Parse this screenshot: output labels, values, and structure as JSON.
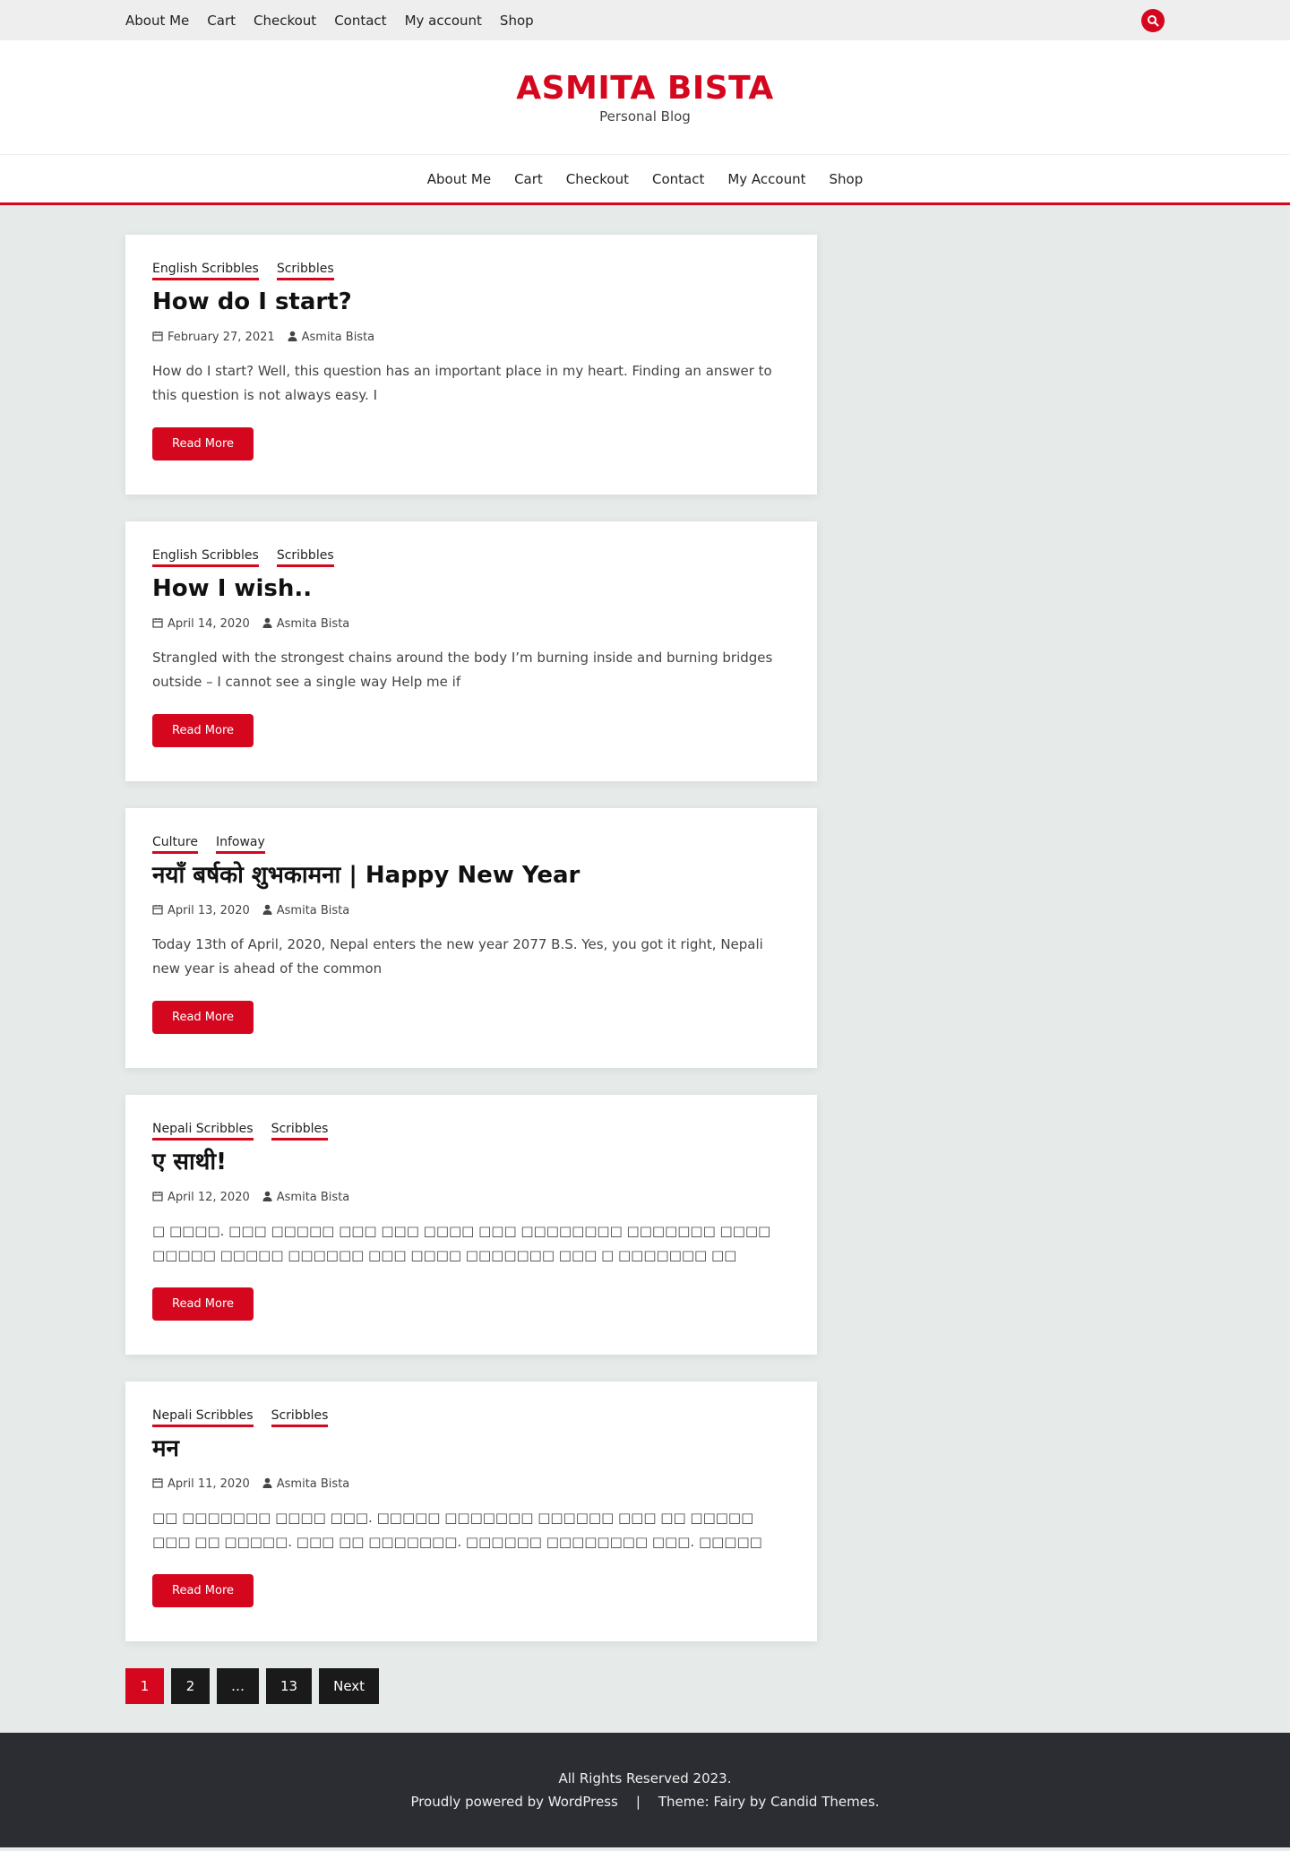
{
  "topbar": {
    "nav": [
      "About Me",
      "Cart",
      "Checkout",
      "Contact",
      "My account",
      "Shop"
    ],
    "search_icon": "search-icon"
  },
  "branding": {
    "title": "ASMITA BISTA",
    "description": "Personal Blog"
  },
  "mainnav": [
    "About Me",
    "Cart",
    "Checkout",
    "Contact",
    "My Account",
    "Shop"
  ],
  "posts": [
    {
      "categories": [
        "English Scribbles",
        "Scribbles"
      ],
      "title": "How do I start?",
      "date": "February 27, 2021",
      "author": "Asmita Bista",
      "excerpt": "How do I start? Well, this question has an important place in my heart. Finding an answer to this question is not always easy. I",
      "read_more": "Read More"
    },
    {
      "categories": [
        "English Scribbles",
        "Scribbles"
      ],
      "title": "How I wish..",
      "date": "April 14, 2020",
      "author": "Asmita Bista",
      "excerpt": "Strangled with the strongest chains around the body I’m burning inside and burning bridges outside – I cannot see a single way Help me if",
      "read_more": "Read More"
    },
    {
      "categories": [
        "Culture",
        "Infoway"
      ],
      "title": "नयाँ बर्षको शुभकामना | Happy New Year",
      "date": "April 13, 2020",
      "author": "Asmita Bista",
      "excerpt": "Today 13th of April, 2020, Nepal enters the new year 2077 B.S. Yes, you got it right, Nepali new year is ahead of the common",
      "read_more": "Read More"
    },
    {
      "categories": [
        "Nepali Scribbles",
        "Scribbles"
      ],
      "title": "ए साथी!",
      "date": "April 12, 2020",
      "author": "Asmita Bista",
      "excerpt": "□ □□□□. □□□ □□□□□ □□□ □□□ □□□□ □□□ □□□□□□□□ □□□□□□□ □□□□ □□□□□ □□□□□ □□□□□□ □□□ □□□□ □□□□□□□ □□□ □ □□□□□□□ □□ □□□□ □□ □□□□ □□□□",
      "read_more": "Read More"
    },
    {
      "categories": [
        "Nepali Scribbles",
        "Scribbles"
      ],
      "title": "मन",
      "date": "April 11, 2020",
      "author": "Asmita Bista",
      "excerpt": "□□ □□□□□□□ □□□□ □□□. □□□□□ □□□□□□□ □□□□□□ □□□ □□ □□□□□ □□□ □□ □□□□□. □□□ □□ □□□□□□□. □□□□□□ □□□□□□□□ □□□. □□□□□ □□□□□ □□□ □□□□□□□ □□□□□. □□",
      "read_more": "Read More"
    }
  ],
  "pagination": [
    "1",
    "2",
    "…",
    "13",
    "Next"
  ],
  "footer": {
    "rights": "All Rights Reserved 2023.",
    "powered": "Proudly powered by WordPress",
    "separator": "|",
    "theme_prefix": "Theme: Fairy by",
    "theme_author": "Candid Themes."
  },
  "colors": {
    "accent": "#d4071e",
    "background": "#e6ebe9",
    "footer": "#2b2d33"
  }
}
